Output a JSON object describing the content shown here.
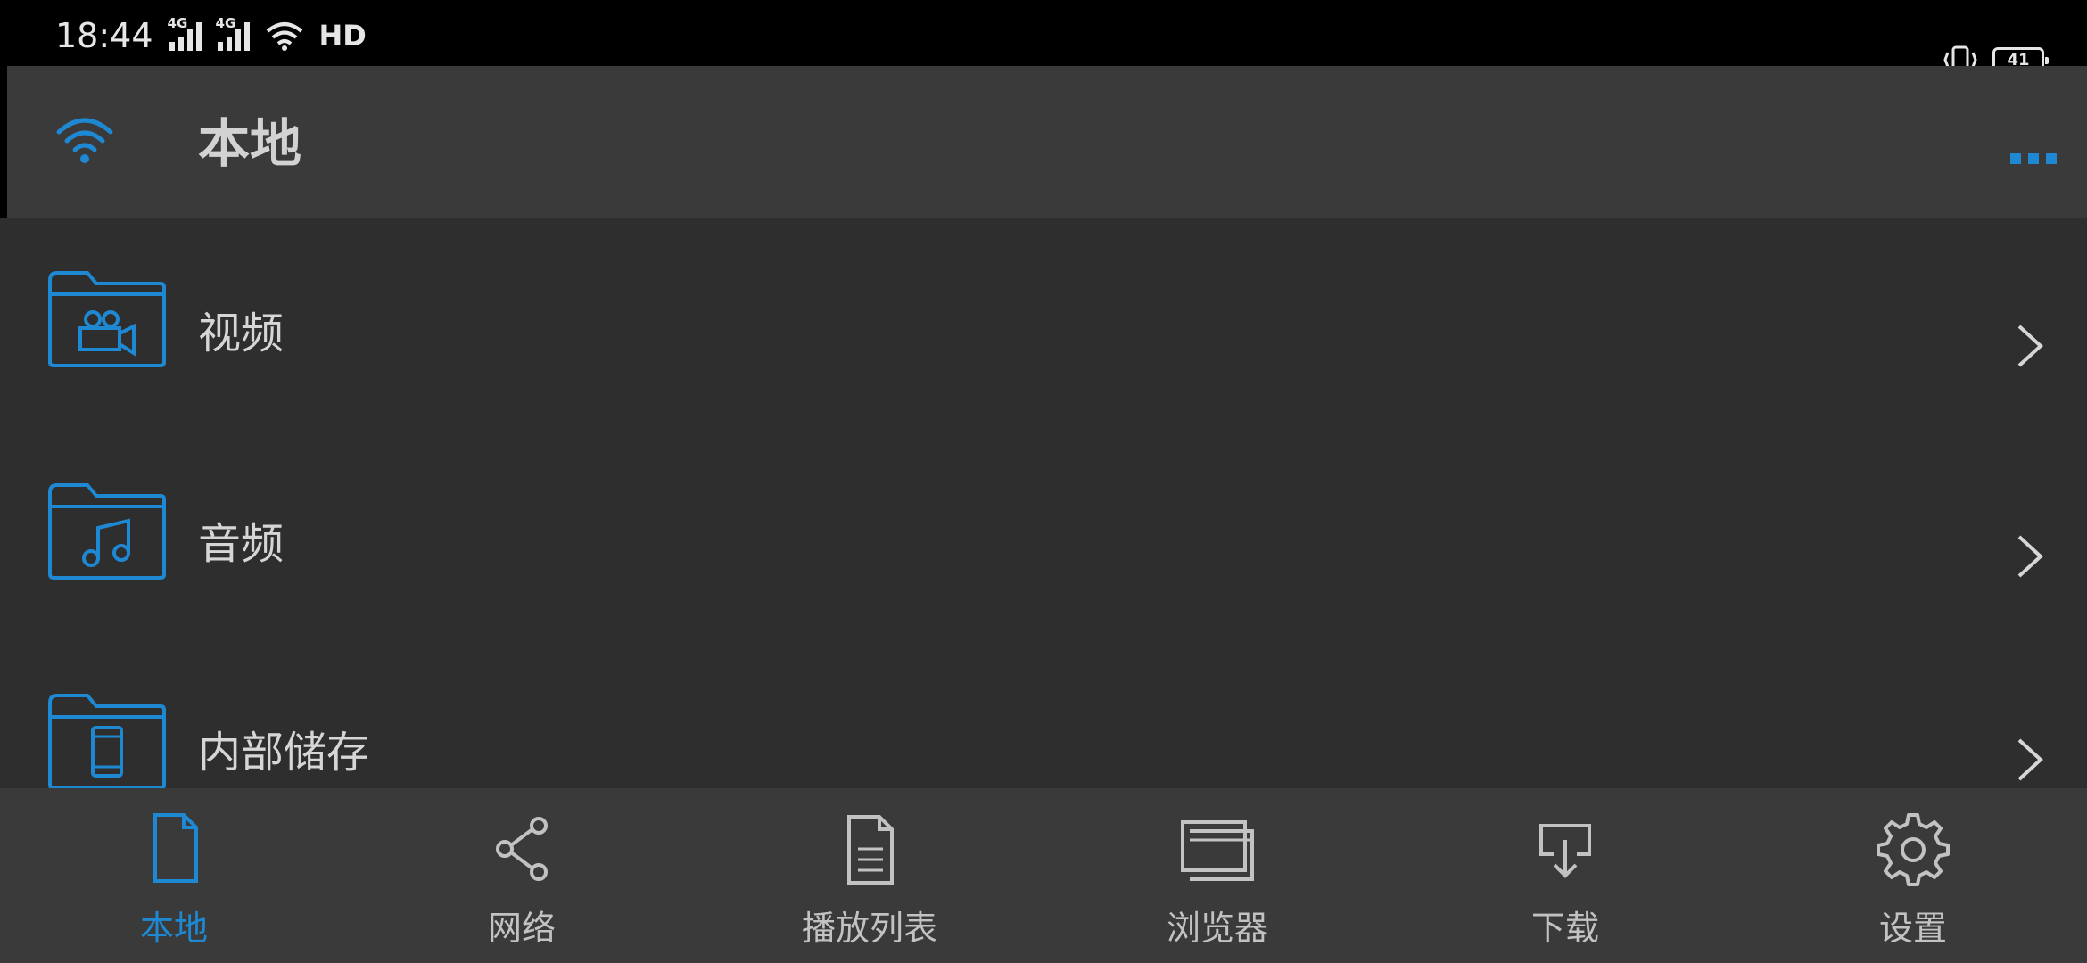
{
  "status_bar": {
    "time": "18:44",
    "signal1_tag": "4G",
    "signal2_tag": "4G",
    "hd": "HD",
    "battery": "41"
  },
  "app_bar": {
    "title": "本地"
  },
  "list": {
    "items": [
      {
        "label": "视频",
        "icon": "video-folder-icon"
      },
      {
        "label": "音频",
        "icon": "audio-folder-icon"
      },
      {
        "label": "内部储存",
        "icon": "phone-storage-folder-icon"
      }
    ]
  },
  "bottom_nav": {
    "items": [
      {
        "label": "本地",
        "icon": "file-icon",
        "active": true
      },
      {
        "label": "网络",
        "icon": "share-icon",
        "active": false
      },
      {
        "label": "播放列表",
        "icon": "document-list-icon",
        "active": false
      },
      {
        "label": "浏览器",
        "icon": "browser-windows-icon",
        "active": false
      },
      {
        "label": "下载",
        "icon": "download-icon",
        "active": false
      },
      {
        "label": "设置",
        "icon": "gear-icon",
        "active": false
      }
    ]
  },
  "colors": {
    "accent": "#1e88d2",
    "background": "#2e2e2e",
    "bar": "#3a3a3a",
    "text": "#d6d6d6"
  }
}
